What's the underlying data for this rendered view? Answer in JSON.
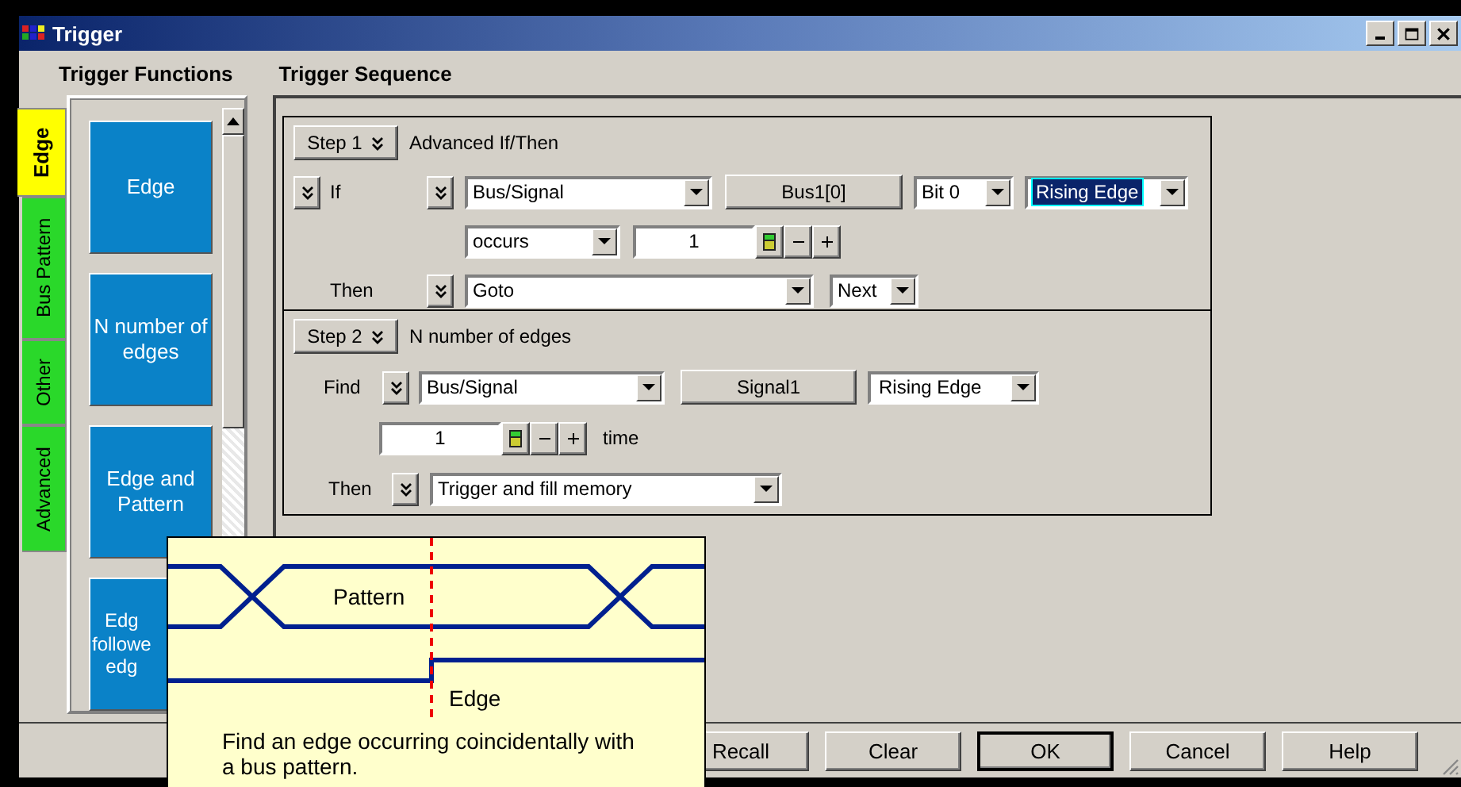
{
  "window": {
    "title": "Trigger"
  },
  "headers": {
    "functions": "Trigger Functions",
    "sequence": "Trigger Sequence"
  },
  "function_tabs": [
    {
      "label": "Edge",
      "selected": true
    },
    {
      "label": "Bus Pattern",
      "selected": false
    },
    {
      "label": "Other",
      "selected": false
    },
    {
      "label": "Advanced",
      "selected": false
    }
  ],
  "functions": [
    {
      "lines": [
        "Edge"
      ]
    },
    {
      "lines": [
        "N number of",
        "edges"
      ]
    },
    {
      "lines": [
        "Edge and",
        "Pattern"
      ]
    },
    {
      "lines": [
        "Edg",
        "followe",
        "edg"
      ]
    }
  ],
  "step1": {
    "button": "Step 1",
    "title": "Advanced If/Then",
    "if_label": "If",
    "signal": "Bus/Signal",
    "bus_button": "Bus1[0]",
    "bit": "Bit 0",
    "edge": {
      "value": "Rising Edge",
      "selected": true
    },
    "occurs": "occurs",
    "count": "1",
    "then_label": "Then",
    "action": "Goto",
    "target": "Next"
  },
  "step2": {
    "button": "Step 2",
    "title": "N number of edges",
    "find_label": "Find",
    "signal": "Bus/Signal",
    "signal_button": "Signal1",
    "edge": {
      "value": "Rising Edge",
      "selected": false
    },
    "count": "1",
    "unit": "time",
    "then_label": "Then",
    "action": "Trigger and fill memory"
  },
  "buttons": [
    {
      "label": "Recall",
      "default": false
    },
    {
      "label": "Clear",
      "default": false
    },
    {
      "label": "OK",
      "default": true
    },
    {
      "label": "Cancel",
      "default": false
    },
    {
      "label": "Help",
      "default": false
    }
  ],
  "tooltip": {
    "pattern_label": "Pattern",
    "edge_label": "Edge",
    "text": "Find an edge occurring coincidentally with a bus pattern."
  }
}
